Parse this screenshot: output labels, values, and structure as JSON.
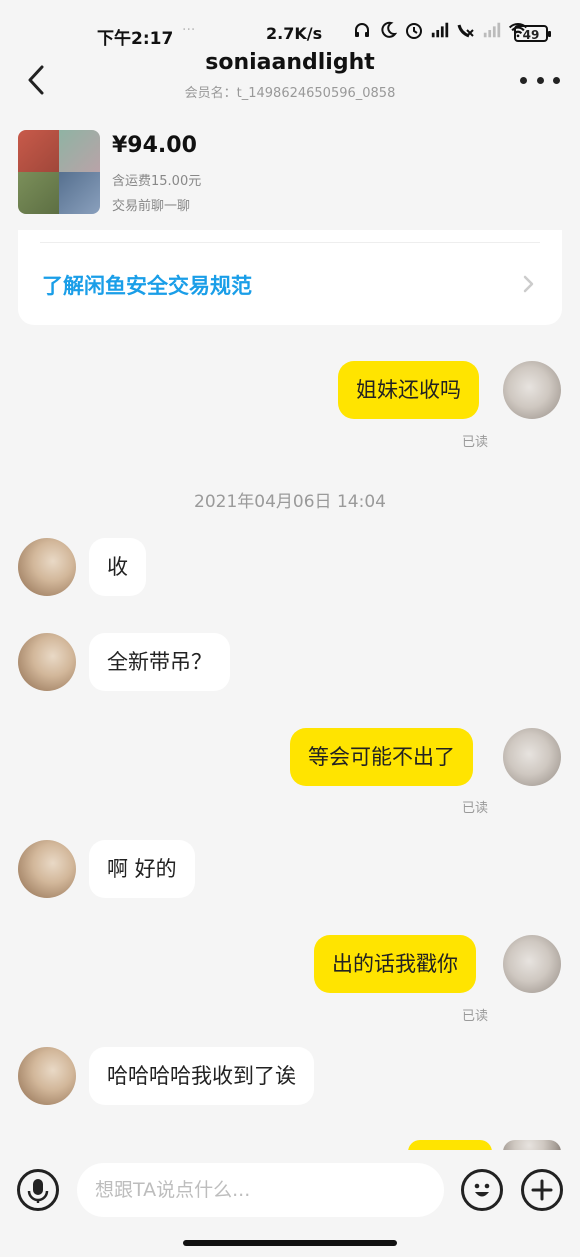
{
  "status_bar": {
    "time": "下午2:17",
    "dots": "···",
    "network_speed": "2.7K/s",
    "icons": [
      "headphones-icon",
      "moon-icon",
      "alarm-icon",
      "signal-icon",
      "signal-icon",
      "wifi-icon"
    ],
    "battery": "49"
  },
  "header": {
    "title": "soniaandlight",
    "subtitle": "会员名：t_1498624650596_0858"
  },
  "product": {
    "price": "¥94.00",
    "shipping": "含运费15.00元",
    "note": "交易前聊一聊"
  },
  "safety": {
    "link": "了解闲鱼安全交易规范"
  },
  "messages": [
    {
      "from": "me",
      "text": "姐妹还收吗",
      "status": "已读"
    },
    {
      "from": "timestamp",
      "text": "2021年04月06日 14:04"
    },
    {
      "from": "other",
      "text": "收"
    },
    {
      "from": "other",
      "text": "全新带吊？"
    },
    {
      "from": "me",
      "text": "等会可能不出了",
      "status": "已读"
    },
    {
      "from": "other",
      "text": "啊 好的"
    },
    {
      "from": "me",
      "text": "出的话我戳你",
      "status": "已读"
    },
    {
      "from": "other",
      "text": "哈哈哈哈我收到了诶"
    }
  ],
  "input": {
    "placeholder": "想跟TA说点什么..."
  },
  "colors": {
    "my_bubble": "#ffe400",
    "link": "#1a9ee8",
    "background": "#f5f5f5"
  }
}
